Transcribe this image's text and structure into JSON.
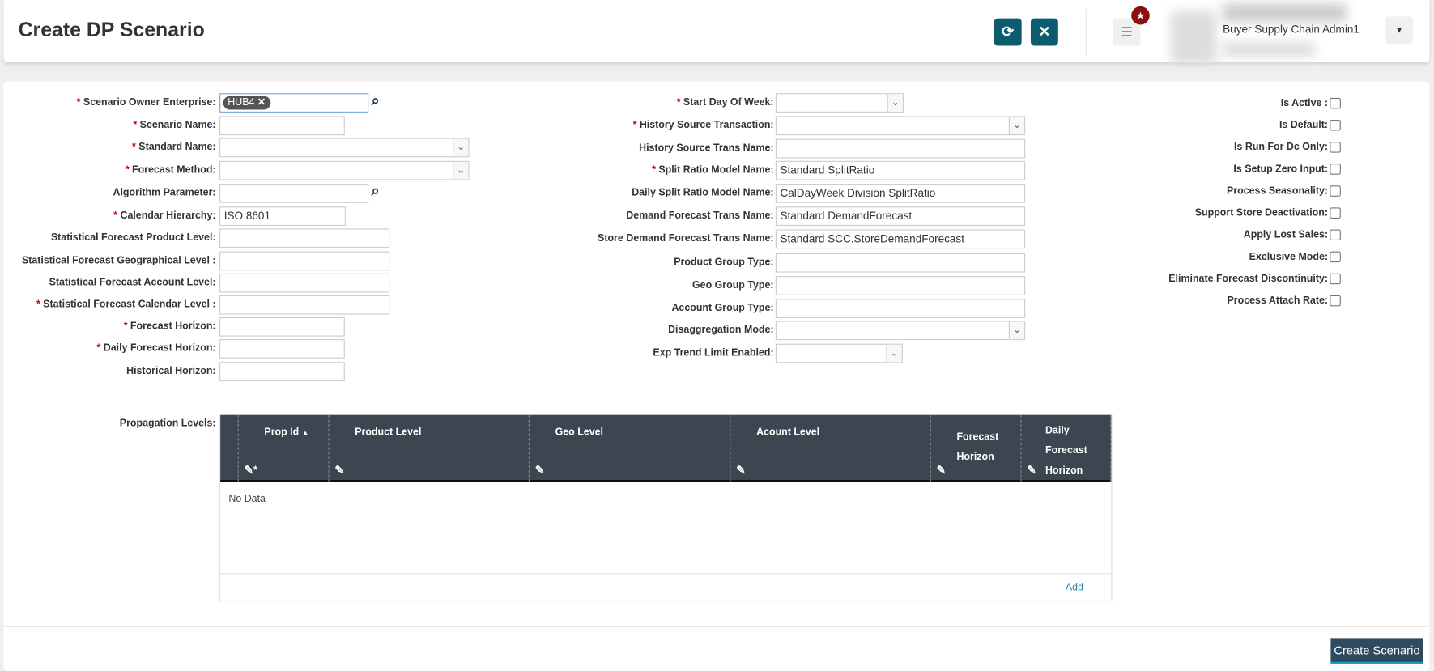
{
  "header": {
    "title": "Create DP Scenario",
    "refresh_icon": "refresh-icon",
    "close_icon": "close-icon",
    "menu_icon": "hamburger-menu-icon",
    "badge_icon": "star-icon",
    "user_name": "Buyer Supply Chain Admin1",
    "user_menu_icon": "chevron-down-icon",
    "accent_color": "#0d5b6f",
    "badge_color": "#8b0f0f"
  },
  "left_fields": [
    {
      "label": "Scenario Owner Enterprise:",
      "required": true,
      "chip": "HUB4"
    },
    {
      "label": "Scenario Name:",
      "required": true,
      "value": ""
    },
    {
      "label": "Standard Name:",
      "required": true,
      "value": ""
    },
    {
      "label": "Forecast Method:",
      "required": true,
      "value": ""
    },
    {
      "label": "Algorithm Parameter:",
      "required": false,
      "value": ""
    },
    {
      "label": "Calendar Hierarchy:",
      "required": true,
      "value": "ISO 8601"
    },
    {
      "label": "Statistical Forecast Product Level:",
      "required": false,
      "value": ""
    },
    {
      "label": "Statistical Forecast Geographical Level :",
      "required": false,
      "value": ""
    },
    {
      "label": "Statistical Forecast Account Level:",
      "required": false,
      "value": ""
    },
    {
      "label": "Statistical Forecast Calendar Level :",
      "required": true,
      "value": ""
    },
    {
      "label": "Forecast Horizon:",
      "required": true,
      "value": ""
    },
    {
      "label": "Daily Forecast Horizon:",
      "required": true,
      "value": ""
    },
    {
      "label": "Historical Horizon:",
      "required": false,
      "value": ""
    }
  ],
  "middle_fields": [
    {
      "label": "Start Day Of Week:",
      "required": true,
      "value": ""
    },
    {
      "label": "History Source Transaction:",
      "required": true,
      "value": ""
    },
    {
      "label": "History Source Trans Name:",
      "required": false,
      "value": ""
    },
    {
      "label": "Split Ratio Model Name:",
      "required": true,
      "value": "Standard SplitRatio"
    },
    {
      "label": "Daily Split Ratio Model Name:",
      "required": false,
      "value": "CalDayWeek Division SplitRatio"
    },
    {
      "label": "Demand Forecast Trans Name:",
      "required": false,
      "value": "Standard DemandForecast"
    },
    {
      "label": "Store Demand Forecast Trans Name:",
      "required": false,
      "value": "Standard SCC.StoreDemandForecast"
    },
    {
      "label": "Product Group Type:",
      "required": false,
      "value": ""
    },
    {
      "label": "Geo Group Type:",
      "required": false,
      "value": ""
    },
    {
      "label": "Account Group Type:",
      "required": false,
      "value": ""
    },
    {
      "label": "Disaggregation Mode:",
      "required": false,
      "value": ""
    },
    {
      "label": "Exp Trend Limit Enabled:",
      "required": false,
      "value": ""
    }
  ],
  "checkboxes": [
    {
      "label": "Is Active :",
      "checked": false
    },
    {
      "label": "Is Default:",
      "checked": false
    },
    {
      "label": "Is Run For Dc Only:",
      "checked": false
    },
    {
      "label": "Is Setup Zero Input:",
      "checked": false
    },
    {
      "label": "Process Seasonality:",
      "checked": false
    },
    {
      "label": "Support Store Deactivation:",
      "checked": false
    },
    {
      "label": "Apply Lost Sales:",
      "checked": false
    },
    {
      "label": "Exclusive Mode:",
      "checked": false
    },
    {
      "label": "Eliminate Forecast Discontinuity:",
      "checked": false
    },
    {
      "label": "Process Attach Rate:",
      "checked": false
    }
  ],
  "propagation": {
    "label": "Propagation Levels:",
    "columns": [
      "Prop Id",
      "Product Level",
      "Geo Level",
      "Acount Level",
      "Forecast Horizon",
      "Daily Forecast Horizon"
    ],
    "sort_indicator": "▲",
    "empty_text": "No Data",
    "add_label": "Add"
  },
  "footer": {
    "create_label": "Create Scenario"
  }
}
